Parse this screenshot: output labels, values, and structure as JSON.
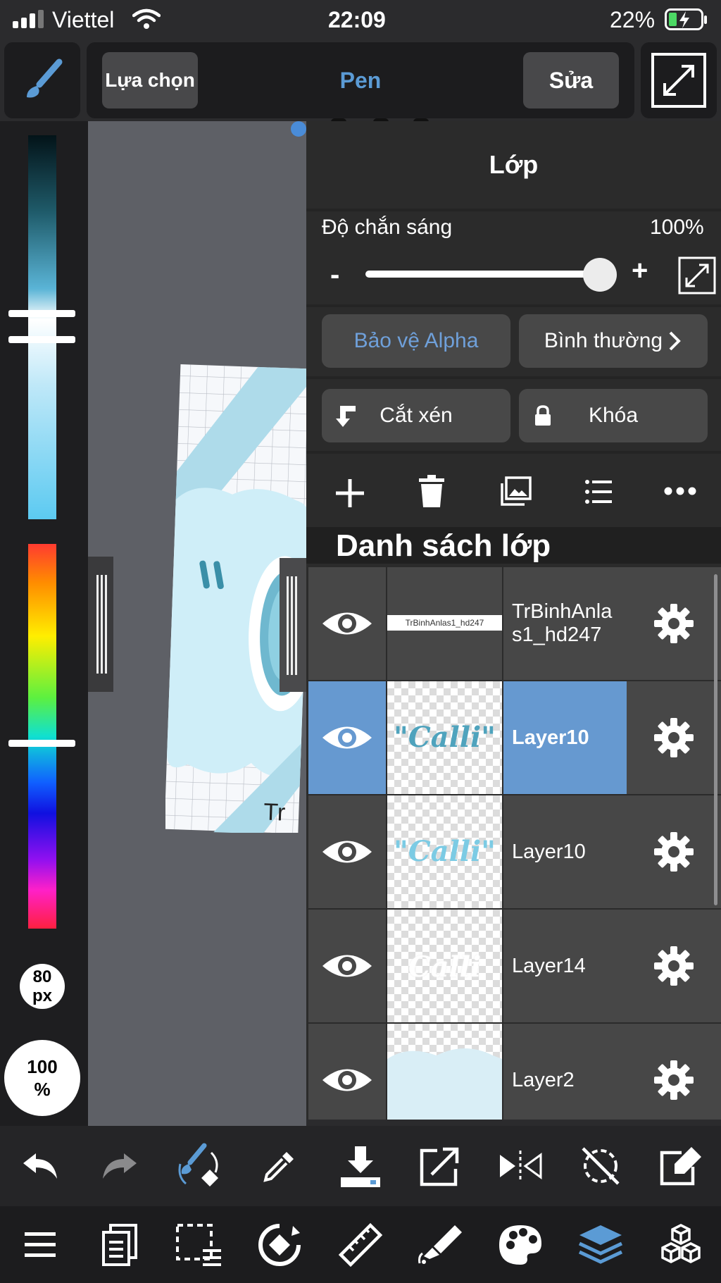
{
  "status_bar": {
    "carrier": "Viettel",
    "time": "22:09",
    "battery": "22%"
  },
  "toolbar": {
    "select_label": "Lựa chọn",
    "tool_name": "Pen",
    "edit_label": "Sửa"
  },
  "left_panel": {
    "brush_size": "80",
    "brush_unit": "px",
    "opacity_value": "100",
    "opacity_unit": "%"
  },
  "canvas": {
    "partial_text": "Tr"
  },
  "layer_panel": {
    "title": "Lớp",
    "opacity_label": "Độ chắn sáng",
    "opacity_value": "100%",
    "opacity_fraction": 0.98,
    "minus": "-",
    "plus": "+",
    "alpha_protect": "Bảo vệ Alpha",
    "blend_mode": "Bình thường",
    "clipping": "Cắt xén",
    "lock": "Khóa",
    "list_title": "Danh sách lớp",
    "layers": [
      {
        "name_line1": "TrBinhAnla",
        "name_line2": "s1_hd247",
        "thumb_text": "TrBinhAnlas1_hd247",
        "selected": false
      },
      {
        "name": "Layer10",
        "thumb_text": "\"Calli\"",
        "selected": true
      },
      {
        "name": "Layer10",
        "thumb_text": "\"Calli\"",
        "selected": false
      },
      {
        "name": "Layer14",
        "thumb_text": "Calli",
        "selected": false
      },
      {
        "name": "Layer2",
        "selected": false
      }
    ]
  },
  "colors": {
    "accent_blue": "#6699d0",
    "tool_blue": "#5b9bd5",
    "alpha_text": "#6fa0da"
  }
}
